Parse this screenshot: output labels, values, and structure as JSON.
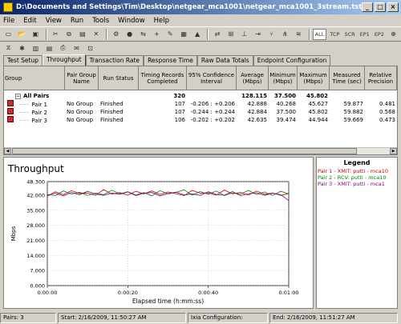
{
  "window": {
    "title": "D:\\Documents and Settings\\Tim\\Desktop\\netgear_mca1001\\netgear_mca1001_3stream.tst"
  },
  "menu": [
    "File",
    "Edit",
    "View",
    "Run",
    "Tools",
    "Window",
    "Help"
  ],
  "toolbar": {
    "protocols": [
      "ALL",
      "TCP",
      "SCR",
      "EP1",
      "EP2"
    ]
  },
  "tabs": [
    "Test Setup",
    "Throughput",
    "Transaction Rate",
    "Response Time",
    "Raw Data Totals",
    "Endpoint Configuration"
  ],
  "grid": {
    "headers": [
      "Group",
      "Pair Group Name",
      "Run Status",
      "Timing Records Completed",
      "95% Confidence Interval",
      "Average (Mbps)",
      "Minimum (Mbps)",
      "Maximum (Mbps)",
      "Measured Time (sec)",
      "Relative Precision"
    ],
    "summary": {
      "label": "All Pairs",
      "records": "320",
      "average": "128.115",
      "minimum": "37.500",
      "maximum": "45.802"
    },
    "rows": [
      {
        "name": "Pair 1",
        "group": "No Group",
        "status": "Finished",
        "records": "107",
        "ci": "-0.206 : +0.206",
        "avg": "42.888",
        "min": "40.268",
        "max": "45.627",
        "time": "59.877",
        "prec": "0.481"
      },
      {
        "name": "Pair 2",
        "group": "No Group",
        "status": "Finished",
        "records": "107",
        "ci": "-0.244 : +0.244",
        "avg": "42.884",
        "min": "37.500",
        "max": "45.802",
        "time": "59.882",
        "prec": "0.568"
      },
      {
        "name": "Pair 3",
        "group": "No Group",
        "status": "Finished",
        "records": "106",
        "ci": "-0.202 : +0.202",
        "avg": "42.635",
        "min": "39.474",
        "max": "44.944",
        "time": "59.669",
        "prec": "0.473"
      }
    ]
  },
  "legend": {
    "title": "Legend",
    "items": [
      {
        "label": "Pair 1 - XMIT: putti - mca10",
        "color": "#c00000"
      },
      {
        "label": "Pair 2 - RCV: putti - mca10",
        "color": "#008000"
      },
      {
        "label": "Pair 3 - XMIT: putti - mca1",
        "color": "#800080"
      }
    ]
  },
  "status": {
    "pairs": "Pairs: 3",
    "start": "Start: 2/16/2009, 11:50:27 AM",
    "ixia": "Ixia Configuration:",
    "end": "End: 2/16/2009, 11:51:27 AM"
  },
  "chart_data": {
    "type": "line",
    "title": "Throughput",
    "xlabel": "Elapsed time (h:mm:ss)",
    "ylabel": "Mbps",
    "xlim": [
      0,
      60
    ],
    "ylim": [
      0,
      48.3
    ],
    "x_ticks": [
      "0:00:00",
      "0:00:20",
      "0:00:40",
      "0:01:00"
    ],
    "y_ticks": [
      "0.000",
      "7.000",
      "14.000",
      "21.000",
      "28.000",
      "35.000",
      "42.000",
      "48.300"
    ],
    "x": [
      0,
      2,
      4,
      6,
      8,
      10,
      12,
      14,
      16,
      18,
      20,
      22,
      24,
      26,
      28,
      30,
      32,
      34,
      36,
      38,
      40,
      42,
      44,
      46,
      48,
      50,
      52,
      54,
      56,
      58,
      60
    ],
    "series": [
      {
        "name": "Pair 1 - XMIT: putti - mca10",
        "color": "#c00000",
        "values": [
          41.5,
          43.6,
          42.2,
          44.1,
          42.8,
          43.0,
          41.9,
          44.6,
          42.5,
          43.2,
          42.0,
          43.8,
          42.6,
          44.0,
          42.3,
          43.5,
          42.7,
          41.8,
          44.2,
          42.9,
          43.1,
          42.0,
          44.4,
          42.6,
          43.3,
          42.1,
          43.9,
          42.4,
          43.0,
          41.9,
          42.8
        ]
      },
      {
        "name": "Pair 2 - RCV: putti - mca10",
        "color": "#008000",
        "values": [
          42.3,
          41.8,
          44.0,
          42.5,
          43.4,
          41.9,
          43.0,
          42.2,
          44.3,
          42.7,
          43.6,
          42.1,
          43.2,
          41.7,
          44.1,
          42.6,
          43.3,
          44.5,
          42.0,
          43.7,
          42.4,
          43.9,
          41.8,
          43.1,
          42.5,
          44.2,
          42.3,
          43.5,
          41.9,
          43.8,
          42.6
        ]
      },
      {
        "name": "Pair 3 - XMIT: putti - mca1",
        "color": "#800080",
        "values": [
          42.0,
          42.9,
          41.6,
          43.3,
          42.2,
          43.8,
          42.5,
          41.9,
          43.0,
          42.4,
          43.5,
          41.8,
          42.9,
          43.2,
          41.7,
          42.8,
          43.4,
          42.1,
          42.6,
          41.9,
          43.6,
          42.3,
          42.0,
          43.7,
          41.8,
          42.7,
          43.1,
          41.9,
          42.9,
          42.2,
          39.5
        ]
      }
    ]
  }
}
